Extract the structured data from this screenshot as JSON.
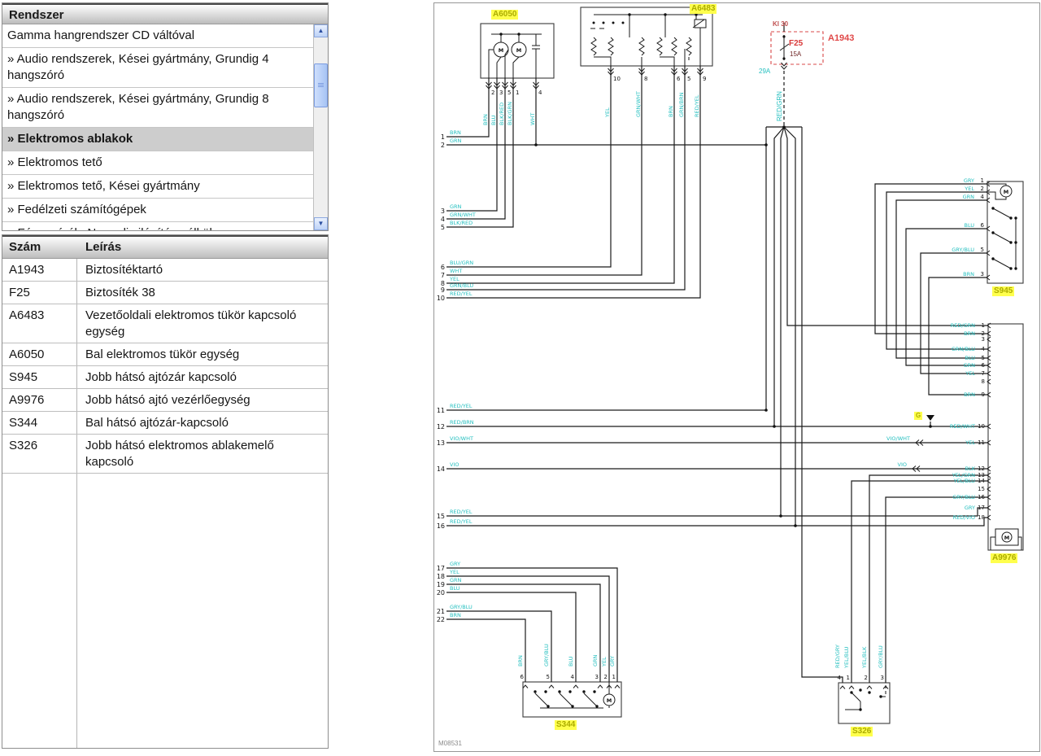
{
  "sidebar": {
    "header": "Rendszer",
    "items": [
      {
        "label": "Gamma hangrendszer CD váltóval",
        "selected": false
      },
      {
        "label": "» Audio rendszerek, Kései gyártmány, Grundig 4 hangszóró",
        "selected": false
      },
      {
        "label": "» Audio rendszerek, Kései gyártmány, Grundig 8 hangszóró",
        "selected": false
      },
      {
        "label": "» Elektromos ablakok",
        "selected": true
      },
      {
        "label": "» Elektromos tető",
        "selected": false
      },
      {
        "label": "» Elektromos tető, Kései gyártmány",
        "selected": false
      },
      {
        "label": "» Fedélzeti számítógépek",
        "selected": false
      },
      {
        "label": "» Fényszórók, Nappali világítás nélkül",
        "selected": false
      }
    ]
  },
  "legend": {
    "col_num": "Szám",
    "col_desc": "Leírás",
    "rows": [
      {
        "num": "A1943",
        "desc": "Biztosítéktartó"
      },
      {
        "num": "F25",
        "desc": "Biztosíték 38"
      },
      {
        "num": "A6483",
        "desc": "Vezetőoldali elektromos tükör kapcsoló egység"
      },
      {
        "num": "A6050",
        "desc": "Bal elektromos tükör egység"
      },
      {
        "num": "S945",
        "desc": "Jobb hátsó ajtózár kapcsoló"
      },
      {
        "num": "A9976",
        "desc": "Jobb hátsó ajtó vezérlőegység"
      },
      {
        "num": "S344",
        "desc": "Bal hátsó ajtózár-kapcsoló"
      },
      {
        "num": "S326",
        "desc": "Jobb hátsó elektromos ablakemelő kapcsoló"
      }
    ]
  },
  "diagram": {
    "footnote": "M08531",
    "motor_glyph": "M",
    "power": {
      "terminal": "Kl 30",
      "holder": "A1943",
      "fuse": "F25",
      "rating": "15A",
      "connector": "29A",
      "wire": "RED/GRN"
    },
    "labels": {
      "a6050": "A6050",
      "a6483": "A6483",
      "s945": "S945",
      "a9976": "A9976",
      "s344": "S344",
      "s326": "S326",
      "ground": "G"
    },
    "stubs": [
      {
        "n": "1",
        "c": "BRN"
      },
      {
        "n": "2",
        "c": "GRN"
      },
      {
        "n": "3",
        "c": "GRN"
      },
      {
        "n": "4",
        "c": "GRN/WHT"
      },
      {
        "n": "5",
        "c": "BLK/RED"
      },
      {
        "n": "6",
        "c": "BLU/GRN"
      },
      {
        "n": "7",
        "c": "WHT"
      },
      {
        "n": "8",
        "c": "YEL"
      },
      {
        "n": "9",
        "c": "GRN/BLU"
      },
      {
        "n": "10",
        "c": "RED/YEL"
      },
      {
        "n": "11",
        "c": "RED/YEL"
      },
      {
        "n": "12",
        "c": "RED/BRN"
      },
      {
        "n": "13",
        "c": "VIO/WHT"
      },
      {
        "n": "14",
        "c": "VIO"
      },
      {
        "n": "15",
        "c": "RED/YEL"
      },
      {
        "n": "16",
        "c": "RED/YEL"
      },
      {
        "n": "17",
        "c": "GRY"
      },
      {
        "n": "18",
        "c": "YEL"
      },
      {
        "n": "19",
        "c": "GRN"
      },
      {
        "n": "20",
        "c": "BLU"
      },
      {
        "n": "21",
        "c": "GRY/BLU"
      },
      {
        "n": "22",
        "c": "BRN"
      }
    ],
    "a6050_pins": [
      {
        "n": "2",
        "c": "BRN"
      },
      {
        "n": "3",
        "c": "BLU"
      },
      {
        "n": "5",
        "c": "BLK/RED"
      },
      {
        "n": "1",
        "c": "BLK/GRN"
      },
      {
        "n": "4",
        "c": "WHT"
      }
    ],
    "a6483_pins": [
      {
        "n": "10",
        "c": "YEL"
      },
      {
        "n": "8",
        "c": "GRN/WHT"
      },
      {
        "n": "6",
        "c": "BRN"
      },
      {
        "n": "5",
        "c": "GRN/BRN"
      },
      {
        "n": "9",
        "c": "RED/YEL"
      }
    ],
    "s945_pins": [
      {
        "n": "1",
        "c": "GRY"
      },
      {
        "n": "2",
        "c": "YEL"
      },
      {
        "n": "4",
        "c": "GRN"
      },
      {
        "n": "6",
        "c": "BLU"
      },
      {
        "n": "5",
        "c": "GRY/BLU"
      },
      {
        "n": "3",
        "c": "BRN"
      }
    ],
    "a9976_pins": [
      {
        "n": "1",
        "c": "RED/GRN"
      },
      {
        "n": "2",
        "c": "BRN"
      },
      {
        "n": "3",
        "c": ""
      },
      {
        "n": "4",
        "c": "GRN/BLU"
      },
      {
        "n": "5",
        "c": "BLU"
      },
      {
        "n": "6",
        "c": "GRN"
      },
      {
        "n": "7",
        "c": "YEL"
      },
      {
        "n": "8",
        "c": ""
      },
      {
        "n": "9",
        "c": "BRN"
      },
      {
        "n": "10",
        "c": "RED/WHT"
      },
      {
        "n": "11",
        "c": "YEL"
      },
      {
        "n": "12",
        "c": "BLK"
      },
      {
        "n": "13",
        "c": "YEL/GRN"
      },
      {
        "n": "14",
        "c": "YEL/BLU"
      },
      {
        "n": "15",
        "c": ""
      },
      {
        "n": "16",
        "c": "GRY/BLU"
      },
      {
        "n": "17",
        "c": "GRY"
      },
      {
        "n": "18",
        "c": "RED/VIO"
      }
    ],
    "s344_pins": [
      {
        "n": "6",
        "c": "BRN"
      },
      {
        "n": "5",
        "c": "GRY/BLU"
      },
      {
        "n": "4",
        "c": "BLU"
      },
      {
        "n": "3",
        "c": "GRN"
      },
      {
        "n": "2",
        "c": "YEL"
      },
      {
        "n": "1",
        "c": "GRY"
      }
    ],
    "s326_pins": [
      {
        "n": "4",
        "c": "RED/GRY"
      },
      {
        "n": "1",
        "c": "YEL/BLU"
      },
      {
        "n": "2",
        "c": "YEL/BLK"
      },
      {
        "n": "3",
        "c": "GRY/BLU"
      }
    ],
    "inline_connectors": [
      {
        "left": "VIO/WHT"
      },
      {
        "left": "VIO"
      }
    ]
  },
  "colors": {
    "wire_label_cyan": "#23BFBF",
    "component_label_bg": "#FFFF4D",
    "component_label_text": "#ACAC00",
    "power_red": "#E04848"
  }
}
